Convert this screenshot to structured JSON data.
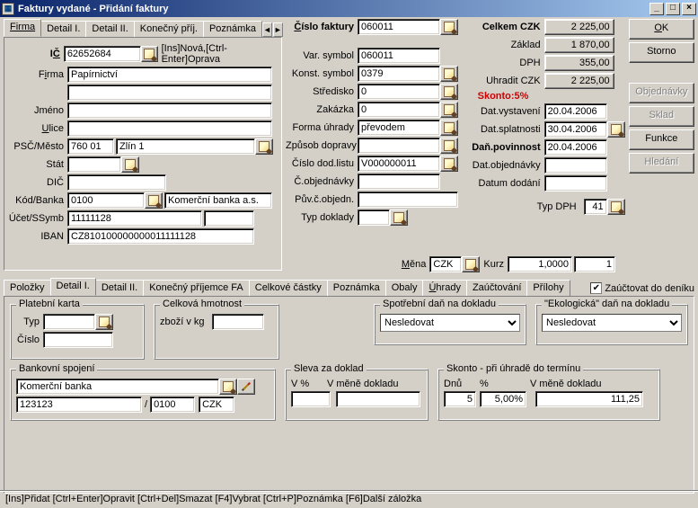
{
  "window": {
    "title": "Faktury vydané - Přidání faktury"
  },
  "topTabs": {
    "t0": "Firma",
    "t1": "Detail I.",
    "t2": "Detail II.",
    "t3": "Konečný příj.",
    "t4": "Poznámka"
  },
  "left": {
    "ic_label_pre": "I",
    "ic_label_ul": "Č",
    "ic": "62652684",
    "hint": "[Ins]Nová,[Ctrl-Enter]Oprava",
    "firma_pre": "F",
    "firma_ul": "i",
    "firma_post": "rma",
    "firma": "Papírnictví",
    "jmeno_label": "Jméno",
    "jmeno": "",
    "ulice_pre": "",
    "ulice_ul": "U",
    "ulice_post": "lice",
    "ulice": "",
    "pscmesto_label": "PSČ/Město",
    "psc": "760 01",
    "mesto": "Zlín 1",
    "stat_label": "Stát",
    "stat": "",
    "dic_label": "DIČ",
    "dic": "",
    "kodbanka_label": "Kód/Banka",
    "kod": "0100",
    "banka": "Komerční banka a.s.",
    "ucetssymb_label": "Účet/SSymb",
    "ucet": "11111128",
    "ssymb": "",
    "iban_label": "IBAN",
    "iban": "CZ810100000000011111128"
  },
  "mid": {
    "cislo_faktury_lbl_ul": "Č",
    "cislo_faktury_lbl_post": "íslo faktury",
    "cislo_faktury": "060011",
    "var_symbol_lbl": "Var. symbol",
    "var_symbol": "060011",
    "konst_symbol_lbl": "Konst. symbol",
    "konst_symbol": "0379",
    "stredisko_lbl": "Středisko",
    "stredisko": "0",
    "zakazka_lbl": "Zakázka",
    "zakazka": "0",
    "forma_uhrady_lbl": "Forma úhrady",
    "forma_uhrady": "převodem",
    "zpusob_dopravy_lbl": "Způsob dopravy",
    "zpusob_dopravy": "",
    "cislo_dod_listu_lbl": "Číslo dod.listu",
    "cislo_dod_listu": "V000000011",
    "c_objednavky_lbl": "Č.objednávky",
    "c_objednavky": "",
    "puv_c_objedn_lbl": "Pův.č.objedn.",
    "puv_c_objedn": "",
    "typ_doklady_lbl": "Typ doklady",
    "typ_doklady": "",
    "mena_lbl_ul": "M",
    "mena_lbl_post": "ěna",
    "mena": "CZK",
    "kurz_lbl": "Kurz",
    "kurz1": "1,0000",
    "kurz2": "1"
  },
  "right": {
    "celkem_lbl": "Celkem CZK",
    "celkem": "2 225,00",
    "zaklad_lbl": "Základ",
    "zaklad": "1 870,00",
    "dph_lbl": "DPH",
    "dph": "355,00",
    "uhradit_lbl": "Uhradit CZK",
    "uhradit": "2 225,00",
    "skonto_lbl": "Skonto:5%",
    "dat_vystaveni_lbl": "Dat.vystavení",
    "dat_vystaveni": "20.04.2006",
    "dat_splatnosti_lbl": "Dat.splatnosti",
    "dat_splatnosti": "30.04.2006",
    "dan_povinnost_lbl": "Daň.povinnost",
    "dan_povinnost": "20.04.2006",
    "dat_objednavky_lbl": "Dat.objednávky",
    "dat_objednavky": "",
    "datum_dodani_lbl": "Datum dodání",
    "datum_dodani": "",
    "typ_dph_lbl": "Typ DPH",
    "typ_dph": "41"
  },
  "buttons": {
    "ok_ul": "O",
    "ok_post": "K",
    "storno": "Storno",
    "objednavky": "Objednávky",
    "sklad": "Sklad",
    "funkce": "Funkce",
    "hledani": "Hledání"
  },
  "tabs2": {
    "polozky": "Položky",
    "detail1": "Detail I.",
    "detail2": "Detail II.",
    "konecny": "Konečný příjemce FA",
    "celkove": "Celkové částky",
    "poznamka": "Poznámka",
    "obaly": "Obaly",
    "uhrady_ul": "Ú",
    "uhrady_post": "hrady",
    "zauctovani": "Zaúčtování",
    "prilohy": "Přílohy",
    "zauctovat_check": "Zaúčtovat do deníku"
  },
  "detail": {
    "platebni_karta": "Platební karta",
    "typ_lbl": "Typ",
    "typ": "",
    "cislo_lbl": "Číslo",
    "cislo": "",
    "celkova_hmotnost": "Celková hmotnost",
    "zbozi_lbl": "zboží v kg",
    "zbozi": "",
    "spotrebni_lbl": "Spotřební daň na dokladu",
    "spotrebni_val": "Nesledovat",
    "eko_lbl": "\"Ekologická\" daň na dokladu",
    "eko_val": "Nesledovat",
    "bankovni_lbl": "Bankovní spojení",
    "banka_nazev": "Komerční banka",
    "banka_ucet": "123123",
    "banka_kod": "0100",
    "banka_mena": "CZK",
    "sleva_lbl": "Sleva za doklad",
    "sleva_vpct_lbl": "V %",
    "sleva_vpct": "",
    "sleva_vmene_lbl": "V měně dokladu",
    "sleva_vmene": "",
    "skonto_lbl": "Skonto - při úhradě do termínu",
    "skonto_dnu_lbl": "Dnů",
    "skonto_dnu": "5",
    "skonto_pct_lbl": "%",
    "skonto_pct": "5,00%",
    "skonto_vmene_lbl": "V měně dokladu",
    "skonto_vmene": "111,25"
  },
  "statusbar": "[Ins]Přidat [Ctrl+Enter]Opravit [Ctrl+Del]Smazat [F4]Vybrat [Ctrl+P]Poznámka [F6]Další záložka"
}
